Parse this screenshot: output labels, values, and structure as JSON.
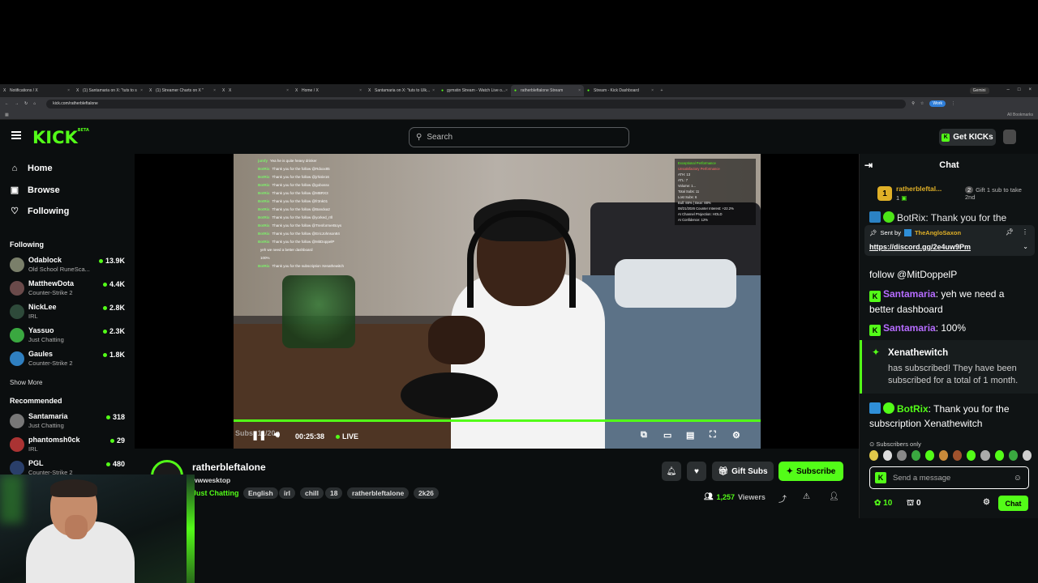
{
  "browser": {
    "tabs": [
      {
        "label": "Notifications / X",
        "fav": "X"
      },
      {
        "label": "(1) Santamaria on X: \"tuts to s",
        "fav": "X"
      },
      {
        "label": "(1) Streamer Charts on X \"",
        "fav": "X"
      },
      {
        "label": "X",
        "fav": "X"
      },
      {
        "label": "Home / X",
        "fav": "X"
      },
      {
        "label": "Santamaria on X: \"tuts to Ulk...",
        "fav": "X"
      },
      {
        "label": "gymstin Stream - Watch Live o...",
        "fav": "●"
      },
      {
        "label": "ratherbleftalone Stream",
        "fav": "●"
      },
      {
        "label": "Stream - Kick Dashboard",
        "fav": "●"
      }
    ],
    "gemini": "Gemini",
    "url": "kick.com/ratherbleftalone",
    "work_label": "Work",
    "all_bookmarks": "All Bookmarks"
  },
  "header": {
    "logo": "KICK",
    "logo_sup": "BETA",
    "search_placeholder": "Search",
    "get_kicks": "Get KICKs"
  },
  "sidebar": {
    "nav": [
      {
        "label": "Home",
        "icon": "home-icon"
      },
      {
        "label": "Browse",
        "icon": "browse-icon"
      },
      {
        "label": "Following",
        "icon": "heart-icon"
      }
    ],
    "following_title": "Following",
    "following": [
      {
        "name": "Odablock",
        "category": "Old School RuneSca...",
        "viewers": "13.9K",
        "color": "#7a7f6a"
      },
      {
        "name": "MatthewDota",
        "category": "Counter-Strike 2",
        "viewers": "4.4K",
        "color": "#6a4a4a"
      },
      {
        "name": "NickLee",
        "category": "IRL",
        "viewers": "2.8K",
        "color": "#2e4a3a"
      },
      {
        "name": "Yassuo",
        "category": "Just Chatting",
        "viewers": "2.3K",
        "color": "#3aa840"
      },
      {
        "name": "Gaules",
        "category": "Counter-Strike 2",
        "viewers": "1.8K",
        "color": "#2f7fc0"
      }
    ],
    "show_more": "Show More",
    "recommended_title": "Recommended",
    "recommended": [
      {
        "name": "Santamaria",
        "category": "Just Chatting",
        "viewers": "318",
        "color": "#777"
      },
      {
        "name": "phantomsh0ck",
        "category": "IRL",
        "viewers": "29",
        "color": "#a33"
      },
      {
        "name": "PGL",
        "category": "Counter-Strike 2",
        "viewers": "480",
        "color": "#2a3f6a"
      }
    ]
  },
  "video": {
    "overlay_chat": [
      {
        "user": "jumfy",
        "text": "Yea he is quite heavy drinker"
      },
      {
        "user": "BotRix",
        "text": "Thank you for the follow @Rdxxx85"
      },
      {
        "user": "BotRix",
        "text": "Thank you for the follow @jrhisle16"
      },
      {
        "user": "BotRix",
        "text": "Thank you for the follow @gobossx"
      },
      {
        "user": "BotRix",
        "text": "Thank you for the follow @MBRX3"
      },
      {
        "user": "BotRix",
        "text": "Thank you for the follow @fr3nk01"
      },
      {
        "user": "BotRix",
        "text": "Thank you for the follow @Bandxa2"
      },
      {
        "user": "BotRix",
        "text": "Thank you for the follow @yorked_rrll"
      },
      {
        "user": "BotRix",
        "text": "Thank you for the follow @TrenformerBoys"
      },
      {
        "user": "BotRix",
        "text": "Thank you for the follow @EricJohnson84"
      },
      {
        "user": "BotRix",
        "text": "Thank you for the follow @MitDoppelP"
      },
      {
        "user": "",
        "text": "yeh we need a better dashboard"
      },
      {
        "user": "",
        "text": "100%"
      },
      {
        "user": "BotRix",
        "text": "Thank you for the subscription Xenathewitch"
      }
    ],
    "overlay_stats": [
      "Exceptional Performance",
      "Unsatisfactory Performance",
      "ATH: 13",
      "ATL: 7",
      "Volume: 1...",
      "Total Subs: 11",
      "Lost Subs: 6",
      "Bull: 88% | Bear: 88%",
      "08/21/2026 Counter Interest: +22.2%",
      "AI Channel Projection: HOLD",
      "AI Confidence: 12%"
    ],
    "time": "00:25:38",
    "live_label": "LIVE",
    "sub_watermark": "Subs: 11/20"
  },
  "channel": {
    "name": "ratherbleftalone",
    "title": "wwwesktop",
    "category": "Just Chatting",
    "tags": [
      "English",
      "irl",
      "chill",
      "18",
      "ratherbleftalone",
      "2k26"
    ],
    "gift_subs": "Gift Subs",
    "subscribe": "Subscribe",
    "viewers": "1,257",
    "viewers_label": "Viewers"
  },
  "chat": {
    "title": "Chat",
    "leader": {
      "rank": "1",
      "name": "ratherbleftal...",
      "count": "1",
      "gift_badge": "2",
      "gift_text": "Gift 1 sub to take 2nd"
    },
    "pinned": {
      "sent_by": "Sent by",
      "user": "TheAngloSaxon",
      "link": "https://discord.gg/2e4uw9Pm"
    },
    "partial_top": "BotRix: Thank you for the",
    "msg_follow": "follow @MitDoppelP",
    "msg1_user": "Santamaria",
    "msg1_text": ": yeh we need a better dashboard",
    "msg2_user": "Santamaria",
    "msg2_text": ": 100%",
    "sub_event": {
      "name": "Xenathewitch",
      "text": "has subscribed! They have been subscribed for a total of 1 month."
    },
    "msg3_user": "BotRix",
    "msg3_text": ": Thank you for the subscription Xenathewitch",
    "subscribers_only": "Subscribers only",
    "input_placeholder": "Send a message",
    "points": "10",
    "points2": "0",
    "chat_button": "Chat"
  },
  "colors": {
    "accent": "#53fc18",
    "gold": "#e0b027",
    "purple": "#b66cff"
  }
}
